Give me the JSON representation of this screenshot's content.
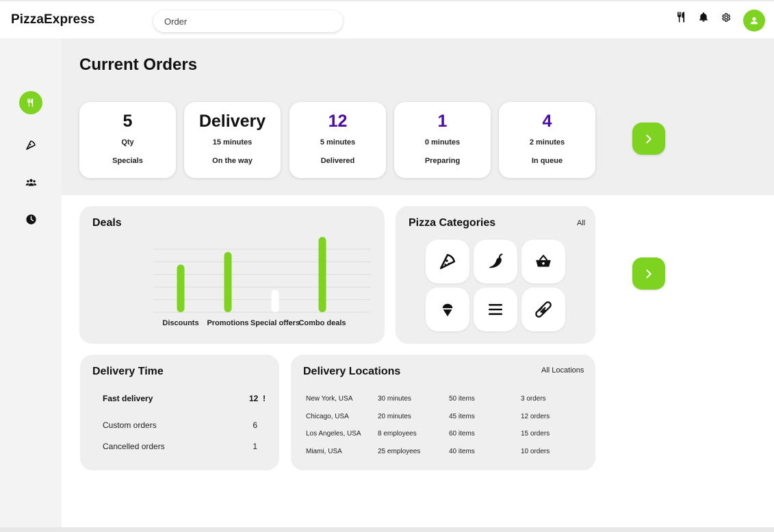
{
  "app": {
    "title": "PizzaExpress"
  },
  "search": {
    "value": "Order"
  },
  "header_icons": [
    "utensils-icon",
    "bell-icon",
    "settings-icon",
    "user-avatar-icon"
  ],
  "sidebar": {
    "items": [
      {
        "icon": "utensils-icon",
        "active": true
      },
      {
        "icon": "pizza-icon",
        "active": false
      },
      {
        "icon": "users-icon",
        "active": false
      },
      {
        "icon": "clock-icon",
        "active": false
      }
    ]
  },
  "page": {
    "title": "Current Orders"
  },
  "stats": [
    {
      "value": "5",
      "sub": "Qty",
      "label": "Specials",
      "highlight": false
    },
    {
      "value": "Delivery",
      "sub": "15 minutes",
      "label": "On the way",
      "highlight": false
    },
    {
      "value": "12",
      "sub": "5 minutes",
      "label": "Delivered",
      "highlight": true
    },
    {
      "value": "1",
      "sub": "0 minutes",
      "label": "Preparing",
      "highlight": true
    },
    {
      "value": "4",
      "sub": "2 minutes",
      "label": "In queue",
      "highlight": true
    }
  ],
  "deals": {
    "title": "Deals",
    "chart_data": {
      "type": "bar",
      "title": "Deals",
      "categories": [
        "Discounts",
        "Promotions",
        "Special offers",
        "Combo deals"
      ],
      "values": [
        3.8,
        4.8,
        1.8,
        6.0
      ],
      "ylim": [
        0,
        6.0
      ],
      "grid": true,
      "colors": [
        "#7ed321",
        "#7ed321",
        "#ffffff",
        "#7ed321"
      ]
    }
  },
  "categories": {
    "title": "Pizza Categories",
    "link": "All",
    "icons": [
      "pizza-slice-icon",
      "pepper-icon",
      "basket-icon",
      "ice-cream-icon",
      "menu-icon",
      "hotdog-icon"
    ]
  },
  "delivery_time": {
    "title": "Delivery Time",
    "rows": [
      {
        "name": "Fast delivery",
        "value": "12  !",
        "bold": true
      },
      {
        "name": "Custom orders",
        "value": "6",
        "bold": false
      },
      {
        "name": "Cancelled orders",
        "value": "1",
        "bold": false
      }
    ]
  },
  "locations": {
    "title": "Delivery Locations",
    "link": "All Locations",
    "rows": [
      [
        "New York, USA",
        "30 minutes",
        "50 items",
        "3 orders"
      ],
      [
        "Chicago, USA",
        "20 minutes",
        "45 items",
        "12 orders"
      ],
      [
        "Los Angeles, USA",
        "8 employees",
        "60 items",
        "15 orders"
      ],
      [
        "Miami, USA",
        "25 employees",
        "40 items",
        "10 orders"
      ]
    ]
  },
  "colors": {
    "accent": "#7ed321",
    "highlight_text": "#4a0aa5",
    "panel": "#efefef"
  }
}
